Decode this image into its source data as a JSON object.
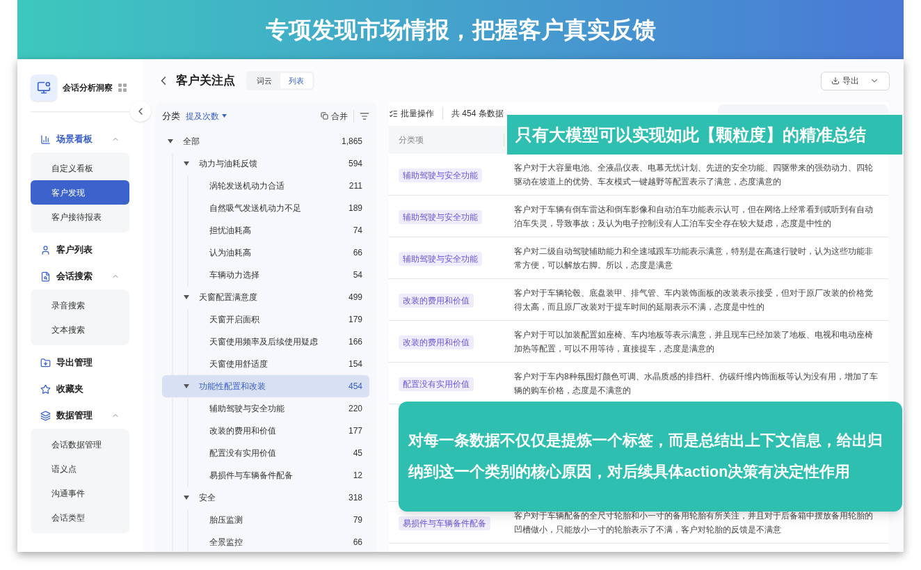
{
  "banner": {
    "title": "专项发现市场情报，把握客户真实反馈"
  },
  "sidebar": {
    "app_title": "会话分析洞察",
    "nav": [
      {
        "label": "场景看板",
        "kind": "group",
        "expanded": true,
        "children": [
          {
            "label": "自定义看板",
            "selected": false
          },
          {
            "label": "客户发现",
            "selected": true
          },
          {
            "label": "客户接待报表",
            "selected": false
          }
        ]
      },
      {
        "label": "客户列表",
        "kind": "item"
      },
      {
        "label": "会话搜索",
        "kind": "group",
        "expanded": true,
        "children": [
          {
            "label": "录音搜索",
            "selected": false
          },
          {
            "label": "文本搜索",
            "selected": false
          }
        ]
      },
      {
        "label": "导出管理",
        "kind": "item"
      },
      {
        "label": "收藏夹",
        "kind": "item"
      },
      {
        "label": "数据管理",
        "kind": "group",
        "expanded": true,
        "children": [
          {
            "label": "会话数据管理",
            "selected": false
          },
          {
            "label": "语义点",
            "selected": false
          },
          {
            "label": "沟通事件",
            "selected": false
          },
          {
            "label": "会话类型",
            "selected": false
          }
        ]
      }
    ]
  },
  "header": {
    "title": "客户关注点",
    "views": [
      {
        "label": "词云",
        "selected": false
      },
      {
        "label": "列表",
        "selected": true
      }
    ],
    "export_button": "导出"
  },
  "tree": {
    "title": "分类",
    "sort": "提及次数",
    "merge_button": "合并",
    "items": [
      {
        "label": "全部",
        "count": "1,865",
        "expanded": true,
        "selected": false,
        "children": [
          {
            "label": "动力与油耗反馈",
            "count": "594",
            "expanded": true,
            "selected": false,
            "children": [
              {
                "label": "涡轮发送机动力合适",
                "count": "211"
              },
              {
                "label": "自然吸气发送机动力不足",
                "count": "189"
              },
              {
                "label": "担忧油耗高",
                "count": "74"
              },
              {
                "label": "认为油耗高",
                "count": "66"
              },
              {
                "label": "车辆动力选择",
                "count": "54"
              }
            ]
          },
          {
            "label": "天窗配置满意度",
            "count": "499",
            "expanded": true,
            "selected": false,
            "children": [
              {
                "label": "天窗开启面积",
                "count": "179"
              },
              {
                "label": "天窗使用频率及后续使用疑虑",
                "count": "166"
              },
              {
                "label": "天窗使用舒适度",
                "count": "154"
              }
            ]
          },
          {
            "label": "功能性配置和改装",
            "count": "454",
            "expanded": true,
            "selected": true,
            "children": [
              {
                "label": "辅助驾驶与安全功能",
                "count": "220"
              },
              {
                "label": "改装的费用和价值",
                "count": "177"
              },
              {
                "label": "配置没有实用价值",
                "count": "45"
              },
              {
                "label": "易损件与车辆备件配备",
                "count": "12"
              }
            ]
          },
          {
            "label": "安全",
            "count": "318",
            "expanded": true,
            "selected": false,
            "children": [
              {
                "label": "胎压监测",
                "count": "79"
              },
              {
                "label": "全景监控",
                "count": "66"
              }
            ]
          }
        ]
      }
    ]
  },
  "table": {
    "batch_button": "批量操作",
    "total": "共 454 条数据",
    "columns": [
      "分类项"
    ],
    "rows": [
      {
        "tag": "辅助驾驶与安全功能",
        "text": "客户对于大容量电池、全液晶仪表、电幕无忧计划、先进的安全功能、四驱带来的强劲动力、四轮驱动在坡道上的优势、车友模式一键越野等配置表示了满意，态度满意的"
      },
      {
        "tag": "辅助驾驶与安全功能",
        "text": "客户对于车辆有倒车雷达和倒车影像和自动泊车功能表示认可，但在网络上经常看到或听到有自动泊车失灵，导致事故；及认为电子控制没有人工泊车安全存在较大疑虑，态度是中性的"
      },
      {
        "tag": "辅助驾驶与安全功能",
        "text": "客户对二级自动驾驶辅助能力和全速域跟车功能表示满意，特别是在高速行驶时，认为这些功能非常方便，可以解放右脚。所以，态度是满意"
      },
      {
        "tag": "改装的费用和价值",
        "text": "客户对于车辆轮毂、底盘装甲、排气管、车内装饰面板的改装表示接受，但对于原厂改装的价格觉得太高，而且原厂改装对于提车时间的延期表示不满，态度是中性的"
      },
      {
        "tag": "改装的费用和价值",
        "text": "客户对于可以加装配置如座椅、车内地板等表示满意，并且现车已经加装了地板、电视和电动座椅加热等配置，可以不用等待，直接提车，态度是满意的"
      },
      {
        "tag": "配置没有实用价值",
        "text": "客户对于车内8种氛围灯颜色可调、水晶质感的排挡杆、仿碳纤维内饰面板等认为没有用，增加了车辆的购车价格，态度是不满意的"
      },
      {
        "tag": "易损件与车辆备件配备",
        "text": "客户对于车辆配备的全尺寸轮胎和小一寸的备用轮胎有所关注，并且对于后备箱中摆放备用轮胎的凹槽做小，只能放小一寸的轮胎表示了不满，客户对轮胎的反馈是不满意"
      }
    ]
  },
  "callouts": [
    {
      "text": "只有大模型可以实现如此【颗粒度】的精准总结"
    },
    {
      "text": "对每一条数据不仅仅是提炼一个标签，而是总结出上下文信息，给出归纳到这一个类别的核心原因，对后续具体action决策有决定性作用"
    }
  ]
}
